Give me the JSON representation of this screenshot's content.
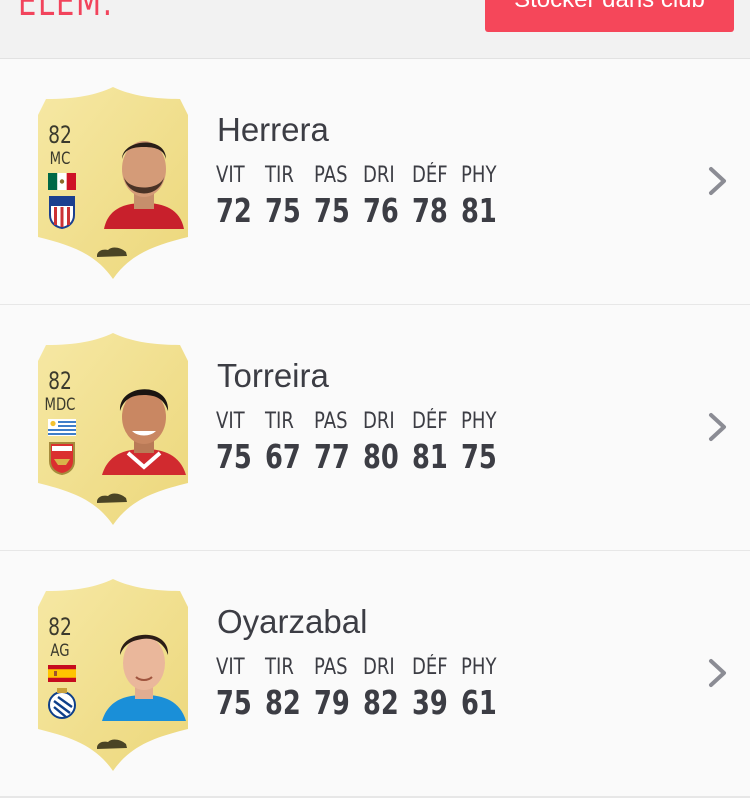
{
  "header": {
    "title_partial": "ELEM.",
    "store_button": "Stocker dans club"
  },
  "stat_labels": [
    "VIT",
    "TIR",
    "PAS",
    "DRI",
    "DÉF",
    "PHY"
  ],
  "players": [
    {
      "name": "Herrera",
      "rating": "82",
      "position": "MC",
      "nation": "Mexico",
      "club": "Atlético Madrid",
      "stats": [
        "72",
        "75",
        "75",
        "76",
        "78",
        "81"
      ],
      "shirt_color": "#c8202c",
      "hair_color": "#2a1e18"
    },
    {
      "name": "Torreira",
      "rating": "82",
      "position": "MDC",
      "nation": "Uruguay",
      "club": "Arsenal",
      "stats": [
        "75",
        "67",
        "77",
        "80",
        "81",
        "75"
      ],
      "shirt_color": "#d12a2f",
      "hair_color": "#1b1512"
    },
    {
      "name": "Oyarzabal",
      "rating": "82",
      "position": "AG",
      "nation": "Spain",
      "club": "Real Sociedad",
      "stats": [
        "75",
        "82",
        "79",
        "82",
        "39",
        "61"
      ],
      "shirt_color": "#1a8fd8",
      "hair_color": "#2b1d16"
    }
  ],
  "colors": {
    "accent": "#f5475a",
    "card_gold": "#f1df8d",
    "text": "#3c3d44",
    "chevron": "#8b8c94"
  }
}
